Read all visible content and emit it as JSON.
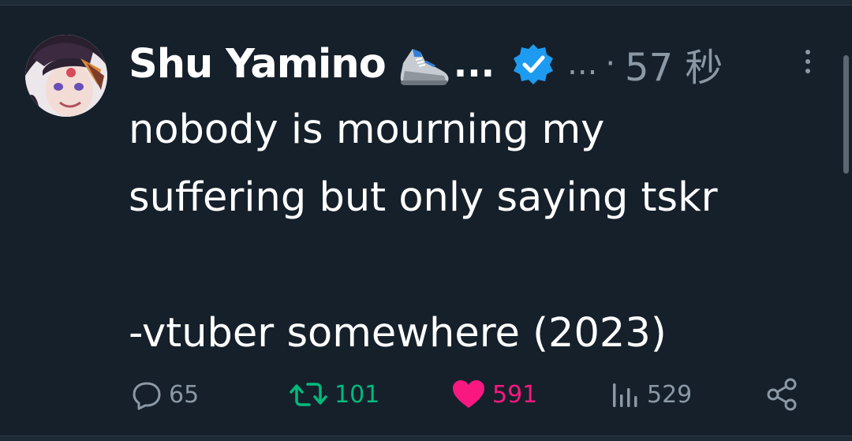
{
  "tweet": {
    "author": {
      "display_name": "Shu Yamino",
      "name_suffix": "...",
      "handle_ellipsis": "...",
      "separator": "·",
      "timestamp": "57 秒",
      "emoji_icon": "running-shoe-icon",
      "verified_icon": "verified-badge-icon"
    },
    "text": "nobody is mourning my\nsuffering but only saying tskr\n\n-vtuber somewhere (2023)",
    "actions": {
      "replies": "65",
      "retweets": "101",
      "likes": "591",
      "views": "529"
    }
  },
  "colors": {
    "background": "#15202b",
    "text": "#ffffff",
    "muted": "#8b98a5",
    "verified": "#1d9bf0",
    "retweet": "#00ba7c",
    "like": "#f91880"
  }
}
